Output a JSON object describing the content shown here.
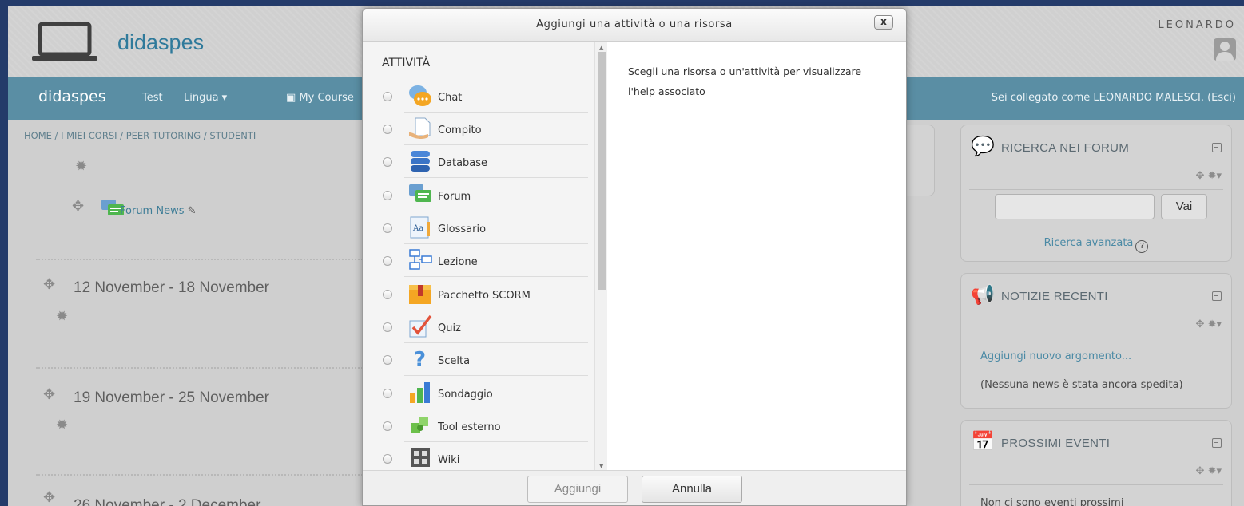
{
  "header": {
    "site_name": "didaspes",
    "user_name": "LEONARDO"
  },
  "navbar": {
    "brand": "didaspes",
    "links": [
      "Test",
      "Lingua ▾",
      "My Course"
    ],
    "login_status": "Sei collegato come LEONARDO MALESCI. (Esci)"
  },
  "breadcrumb": "HOME / I MIEI CORSI / PEER TUTORING / STUDENTI",
  "course": {
    "forum_link": "Forum News",
    "weeks": [
      "12 November - 18 November",
      "19 November - 25 November",
      "26 November - 2 December"
    ]
  },
  "blocks": {
    "forum_search": {
      "title": "RICERCA NEI FORUM",
      "button": "Vai",
      "advanced": "Ricerca avanzata"
    },
    "news": {
      "title": "NOTIZIE RECENTI",
      "add_link": "Aggiungi nuovo argomento...",
      "empty": "(Nessuna news è stata ancora spedita)"
    },
    "events": {
      "title": "PROSSIMI EVENTI",
      "empty": "Non ci sono eventi prossimi"
    }
  },
  "dialog": {
    "title": "Aggiungi una attività o una risorsa",
    "close": "x",
    "section": "ATTIVITÀ",
    "options": [
      {
        "label": "Chat",
        "icon": "chat-icon"
      },
      {
        "label": "Compito",
        "icon": "assignment-icon"
      },
      {
        "label": "Database",
        "icon": "database-icon"
      },
      {
        "label": "Forum",
        "icon": "forum-icon"
      },
      {
        "label": "Glossario",
        "icon": "glossary-icon"
      },
      {
        "label": "Lezione",
        "icon": "lesson-icon"
      },
      {
        "label": "Pacchetto SCORM",
        "icon": "scorm-icon"
      },
      {
        "label": "Quiz",
        "icon": "quiz-icon"
      },
      {
        "label": "Scelta",
        "icon": "choice-icon"
      },
      {
        "label": "Sondaggio",
        "icon": "survey-icon"
      },
      {
        "label": "Tool esterno",
        "icon": "external-tool-icon"
      },
      {
        "label": "Wiki",
        "icon": "wiki-icon"
      }
    ],
    "help_text": "Scegli una risorsa o un'attività per visualizzare l'help associato",
    "add_button": "Aggiungi",
    "cancel_button": "Annulla"
  }
}
